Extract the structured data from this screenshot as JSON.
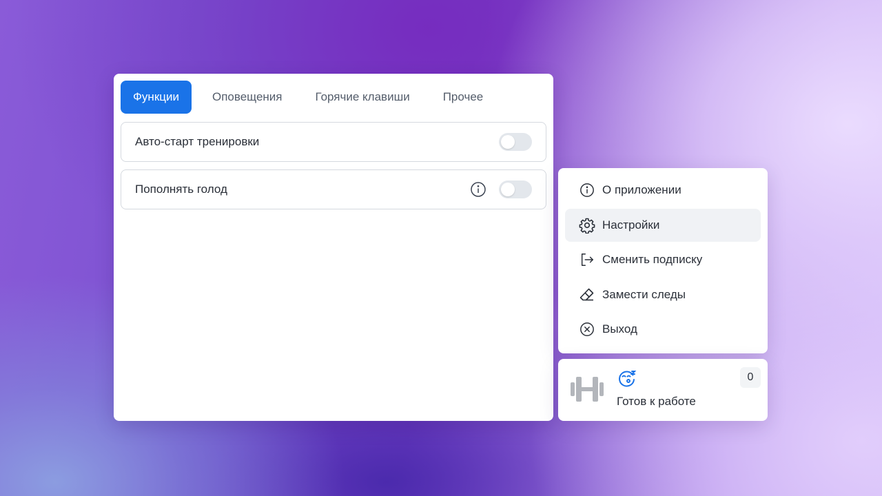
{
  "settings": {
    "tabs": [
      {
        "label": "Функции",
        "active": true
      },
      {
        "label": "Оповещения",
        "active": false
      },
      {
        "label": "Горячие клавиши",
        "active": false
      },
      {
        "label": "Прочее",
        "active": false
      }
    ],
    "rows": [
      {
        "label": "Авто-старт тренировки",
        "enabled": false,
        "has_info": false
      },
      {
        "label": "Пополнять голод",
        "enabled": false,
        "has_info": true
      }
    ]
  },
  "menu": {
    "items": [
      {
        "label": "О приложении",
        "icon": "info-icon",
        "active": false
      },
      {
        "label": "Настройки",
        "icon": "gear-icon",
        "active": true
      },
      {
        "label": "Сменить подписку",
        "icon": "logout-icon",
        "active": false
      },
      {
        "label": "Замести следы",
        "icon": "eraser-icon",
        "active": false
      },
      {
        "label": "Выход",
        "icon": "close-circle-icon",
        "active": false
      }
    ]
  },
  "status": {
    "text": "Готов к работе",
    "count": "0",
    "icon": "dumbbell-icon",
    "mood_icon": "sleepy-face-icon"
  },
  "colors": {
    "accent": "#1a73e8",
    "text": "#2a2f38",
    "muted": "#545d6b"
  }
}
